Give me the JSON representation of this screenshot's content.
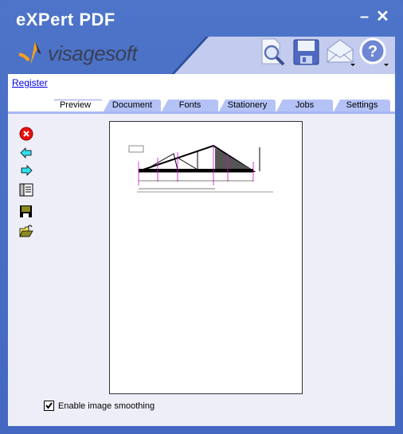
{
  "window": {
    "title": "eXPert PDF",
    "minimize_label": "–",
    "close_label": "✕"
  },
  "brand": {
    "logo_text": "visagesoft"
  },
  "toolbar": [
    {
      "name": "preview-icon"
    },
    {
      "name": "save-icon"
    },
    {
      "name": "email-icon"
    },
    {
      "name": "help-icon"
    }
  ],
  "register_link": "Register",
  "tabs": [
    {
      "label": "Preview",
      "active": true
    },
    {
      "label": "Document"
    },
    {
      "label": "Fonts"
    },
    {
      "label": "Stationery"
    },
    {
      "label": "Jobs"
    },
    {
      "label": "Settings"
    }
  ],
  "side_buttons": [
    "cancel-icon",
    "back-arrow-icon",
    "forward-arrow-icon",
    "document-properties-icon",
    "save-icon",
    "open-folder-icon"
  ],
  "smoothing": {
    "label": "Enable image smoothing",
    "checked": true
  },
  "colors": {
    "frame": "#4a72c8",
    "tab": "#b4c2f6",
    "pane": "#eeeef8",
    "banner": "#c3ccee"
  }
}
